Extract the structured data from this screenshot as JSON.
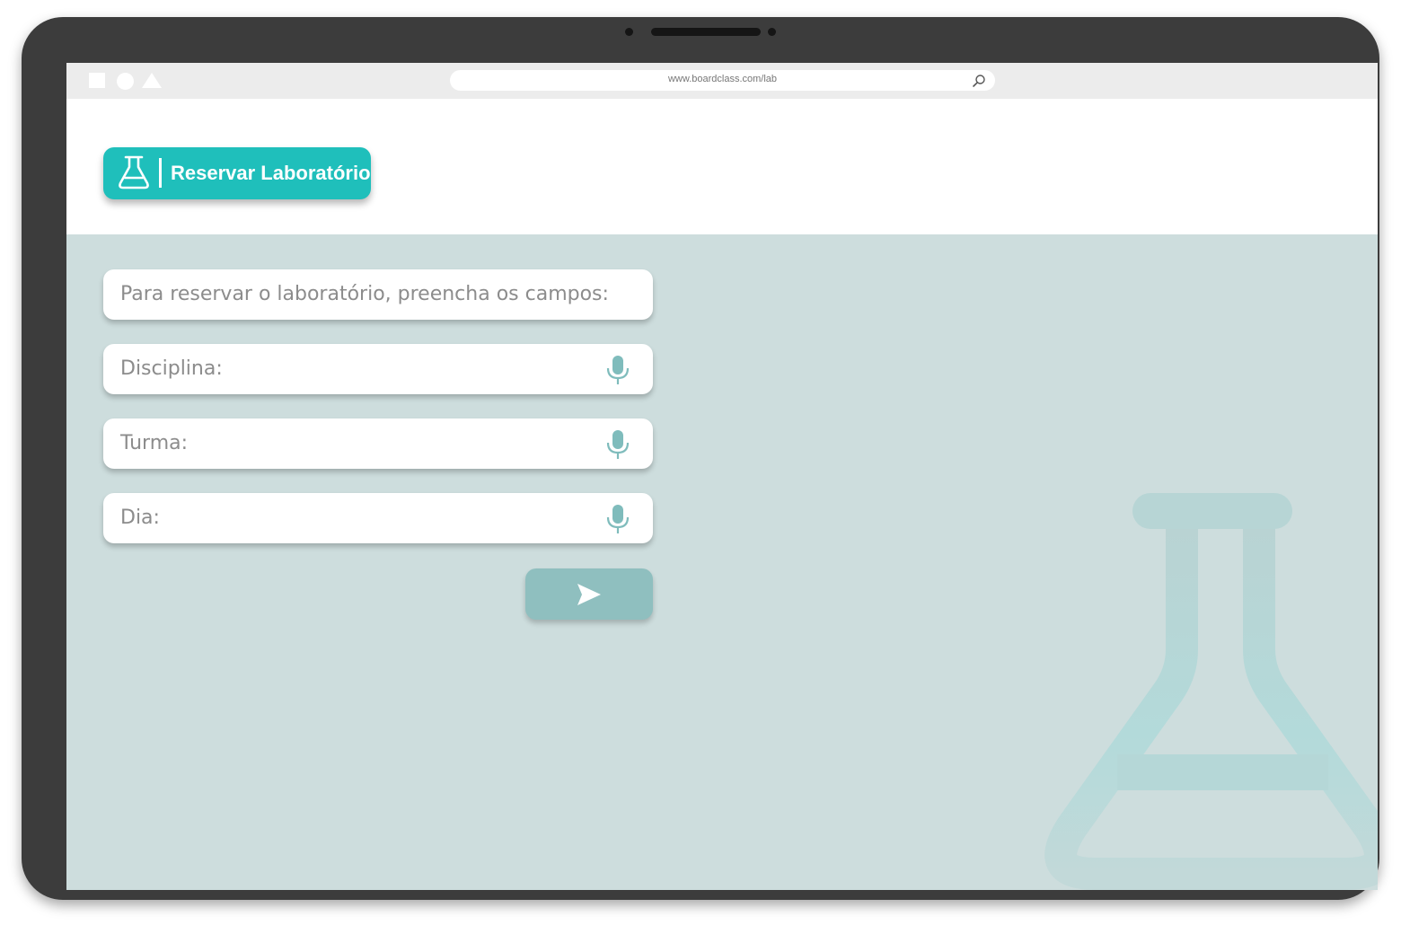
{
  "browser": {
    "url": "www.boardclass.com/lab"
  },
  "header": {
    "button_label": "Reservar Laboratório"
  },
  "form": {
    "instruction": "Para reservar o laboratório, preencha os campos:",
    "fields": [
      {
        "label": "Disciplina:",
        "icon": "microphone-icon"
      },
      {
        "label": "Turma:",
        "icon": "microphone-icon"
      },
      {
        "label": "Dia:",
        "icon": "microphone-icon"
      }
    ],
    "submit_icon": "send-icon"
  },
  "colors": {
    "accent": "#1fbfbb",
    "background": "#cddddd",
    "send_button": "#8fbfbf",
    "mic_icon": "#7fbcbc",
    "device_frame": "#3c3c3c"
  }
}
